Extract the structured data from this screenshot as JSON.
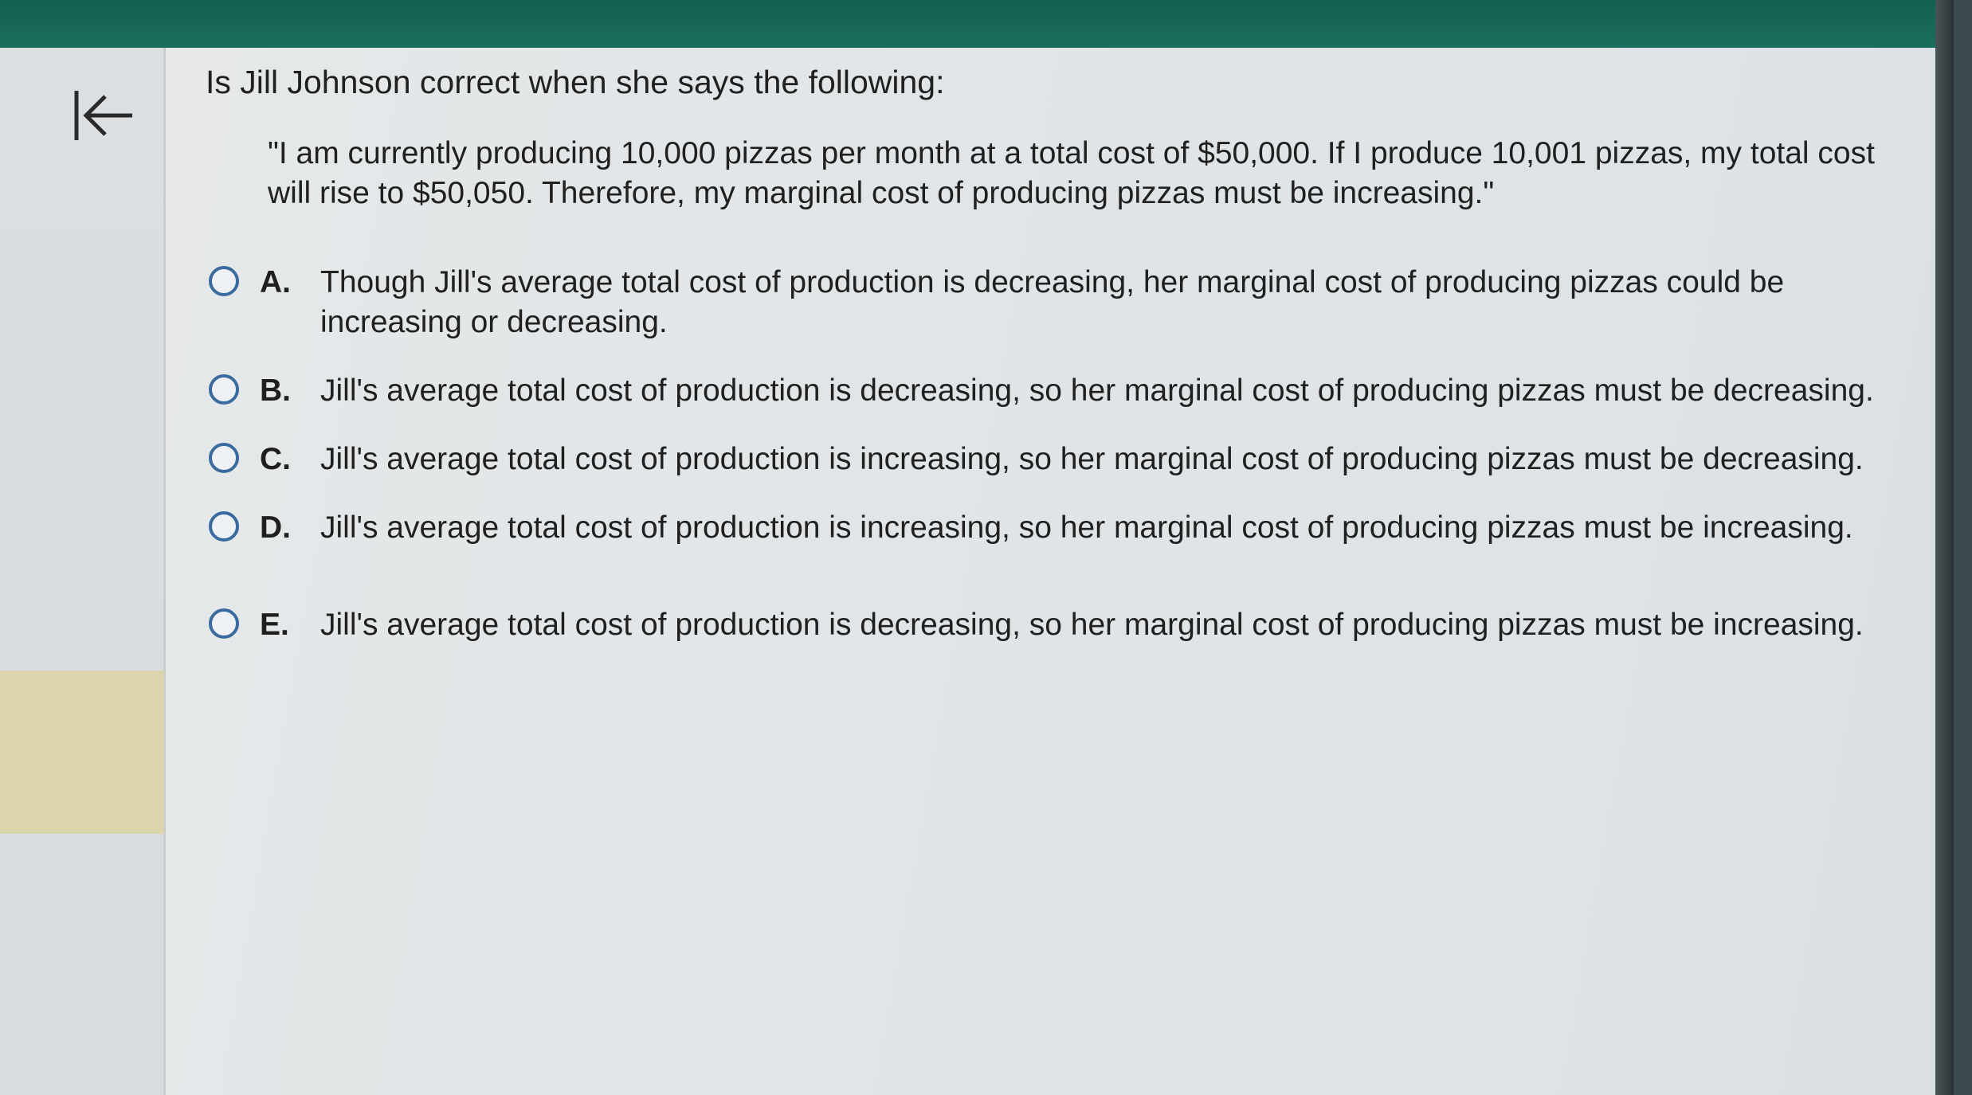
{
  "nav": {
    "back_icon": "arrow-left-to-bar-icon"
  },
  "colors": {
    "top_bar": "#13604f",
    "radio_border": "#3a6b9e",
    "highlight_block": "#dcd4ad"
  },
  "question": {
    "prompt": "Is Jill Johnson correct when she says the following:",
    "quote": "\"I am currently producing 10,000 pizzas per month at a total cost of $50,000. If I produce 10,001 pizzas, my total cost will rise to $50,050. Therefore, my marginal cost of producing pizzas must be increasing.\""
  },
  "options": [
    {
      "letter": "A.",
      "text": "Though Jill's average total cost of production is decreasing, her marginal cost of producing pizzas could be increasing or decreasing."
    },
    {
      "letter": "B.",
      "text": "Jill's average total cost of production is decreasing, so her marginal cost of producing pizzas must be decreasing."
    },
    {
      "letter": "C.",
      "text": "Jill's average total cost of production is increasing, so her marginal cost of producing pizzas must be decreasing."
    },
    {
      "letter": "D.",
      "text": "Jill's average total cost of production is increasing, so her marginal cost of producing pizzas must be increasing."
    },
    {
      "letter": "E.",
      "text": "Jill's average total cost of production is decreasing, so her marginal cost of producing pizzas must be increasing."
    }
  ]
}
